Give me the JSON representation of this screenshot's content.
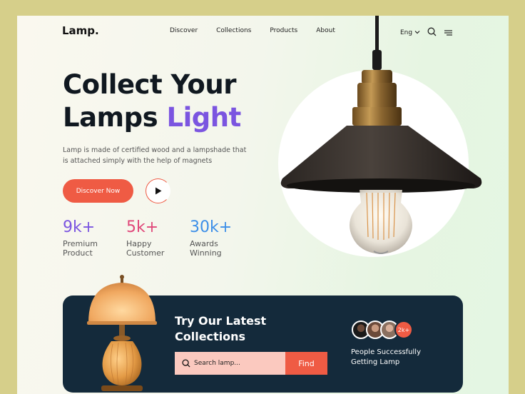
{
  "nav": {
    "logo": "Lamp.",
    "links": [
      "Discover",
      "Collections",
      "Products",
      "About"
    ],
    "language": "Eng",
    "icons": [
      "chevron-down-icon",
      "search-icon",
      "menu-icon"
    ]
  },
  "hero": {
    "title_line1": "Collect Your",
    "title_line2_plain": "Lamps ",
    "title_line2_accent": "Light",
    "description": "Lamp is made of certified wood and a lampshade that is attached simply with the help of magnets",
    "cta_label": "Discover Now",
    "play_icon": "play-icon"
  },
  "stats": [
    {
      "value": "9k+",
      "label": "Premium Product",
      "color": "#7b55e0"
    },
    {
      "value": "5k+",
      "label": "Happy Customer",
      "color": "#e0487a"
    },
    {
      "value": "30k+",
      "label": "Awards Winning",
      "color": "#3d8fe8"
    }
  ],
  "promo": {
    "title": "Try Our Latest Collections",
    "search_placeholder": "Search lamp...",
    "find_label": "Find",
    "avatar_count": "2k+",
    "people_text": "People Successfully Getting Lamp"
  },
  "colors": {
    "accent": "#ef5b44",
    "purple": "#7b55e0",
    "dark_panel": "#142a3b"
  }
}
